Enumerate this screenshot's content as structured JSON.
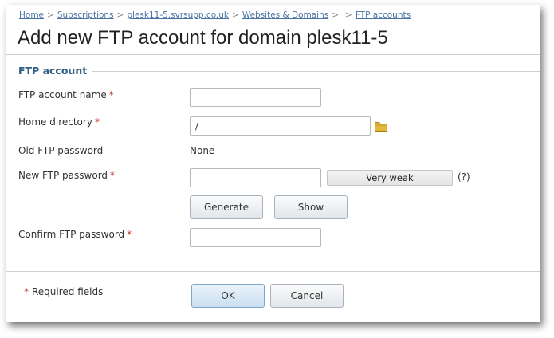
{
  "breadcrumb": {
    "items": [
      "Home",
      "Subscriptions",
      "plesk11-5.svrsupp.co.uk",
      "Websites & Domains",
      "",
      "FTP accounts"
    ],
    "separator": ">"
  },
  "page": {
    "title": "Add new FTP account for domain plesk11-5"
  },
  "section": {
    "title": "FTP account"
  },
  "form": {
    "account_name": {
      "label": "FTP account name",
      "required": "*",
      "value": ""
    },
    "home_directory": {
      "label": "Home directory",
      "required": "*",
      "value": "/",
      "icon": "folder-icon"
    },
    "old_password": {
      "label": "Old FTP password",
      "value": "None"
    },
    "new_password": {
      "label": "New FTP password",
      "required": "*",
      "value": "",
      "strength": "Very weak",
      "help": "(?)"
    },
    "generate_label": "Generate",
    "show_label": "Show",
    "confirm_password": {
      "label": "Confirm FTP password",
      "required": "*",
      "value": ""
    }
  },
  "footer": {
    "required_star": "*",
    "required_text": "Required fields",
    "ok_label": "OK",
    "cancel_label": "Cancel"
  },
  "colors": {
    "link": "#4a73a3",
    "section_title": "#2e5f86",
    "required": "#c0332b",
    "folder": "#d4a62a"
  }
}
